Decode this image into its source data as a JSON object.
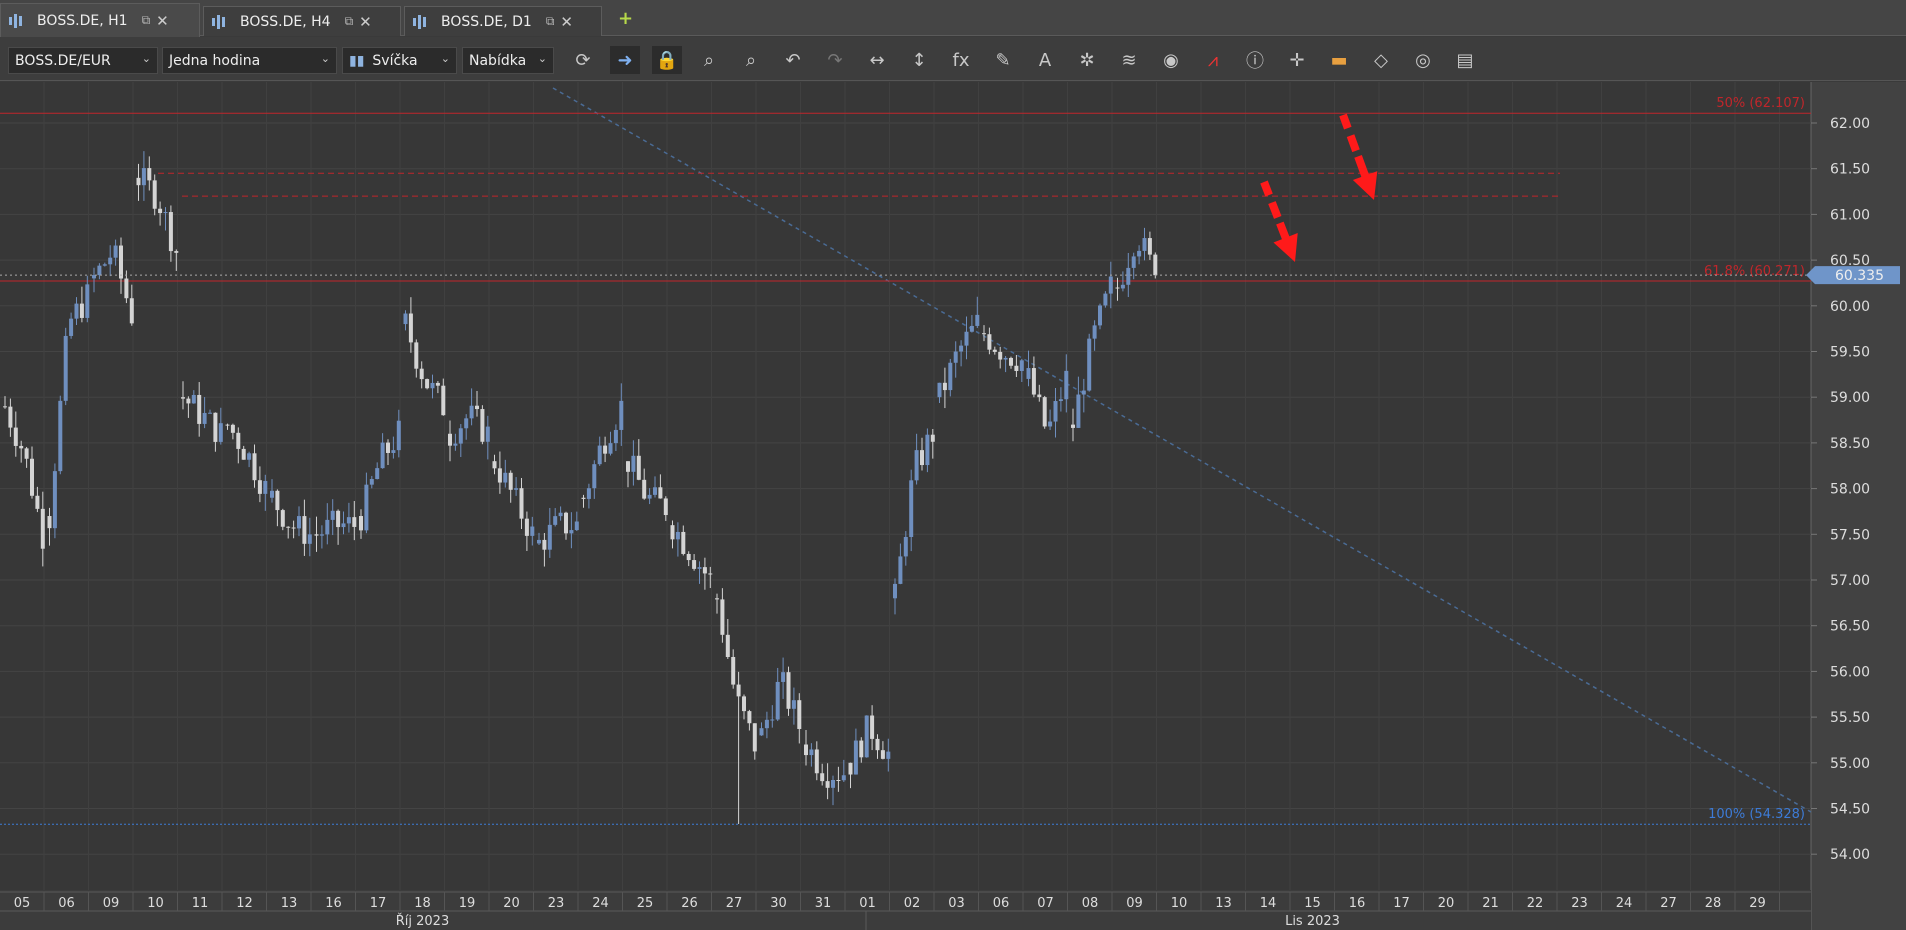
{
  "tabs": [
    {
      "label": "BOSS.DE, H1",
      "active": true
    },
    {
      "label": "BOSS.DE, H4",
      "active": false
    },
    {
      "label": "BOSS.DE, D1",
      "active": false
    }
  ],
  "toolbar": {
    "symbol": "BOSS.DE/EUR",
    "timeframe": "Jedna hodina",
    "chart_type": "Svíčka",
    "price_side": "Nabídka",
    "icons": [
      "refresh-icon",
      "autoscroll-icon",
      "lock-icon",
      "zoom-in-icon",
      "zoom-box-icon",
      "undo-icon",
      "redo-icon",
      "horizontal-scale-icon",
      "vertical-scale-icon",
      "fx-icon",
      "pencil-icon",
      "compass-icon",
      "objects-icon",
      "layers-icon",
      "eye-icon",
      "signal-icon",
      "info-icon",
      "crosshair-icon",
      "color-bar-icon",
      "paint-bucket-icon",
      "aperture-icon",
      "save-icon"
    ],
    "icon_glyphs": [
      "⟳",
      "➜",
      "🔒",
      "⌕",
      "⌕",
      "↶",
      "↷",
      "↔",
      "↕",
      "fx",
      "✎",
      "A",
      "✲",
      "≋",
      "◉",
      "⩘",
      "ⓘ",
      "✛",
      "▬",
      "◇",
      "◎",
      "▤"
    ]
  },
  "colors": {
    "bull": "#6f8fbf",
    "bear": "#d4d4d4",
    "fib_red": "#c0262b",
    "fib_blue": "#3d7bd6",
    "arrow": "#ff1a1a",
    "current": "#6f95c9"
  },
  "chart_data": {
    "type": "candlestick",
    "ylim": [
      53.6,
      62.5
    ],
    "y_ticks": [
      "54.00",
      "54.50",
      "55.00",
      "55.50",
      "56.00",
      "56.50",
      "57.00",
      "57.50",
      "58.00",
      "58.50",
      "59.00",
      "59.50",
      "60.00",
      "60.50",
      "61.00",
      "61.50",
      "62.00"
    ],
    "x_labels": [
      "05",
      "06",
      "09",
      "10",
      "11",
      "12",
      "13",
      "16",
      "17",
      "18",
      "19",
      "20",
      "23",
      "24",
      "25",
      "26",
      "27",
      "30",
      "31",
      "01",
      "02",
      "03",
      "06",
      "07",
      "08",
      "09",
      "10",
      "13",
      "14",
      "15",
      "16",
      "17",
      "20",
      "21",
      "22",
      "23",
      "24",
      "27",
      "28",
      "29"
    ],
    "month_labels": [
      {
        "label": "Říj 2023",
        "at_index": 9
      },
      {
        "label": "Lis 2023",
        "at_index": 29
      }
    ],
    "daily_path": [
      [
        58.9,
        58.4,
        57.5
      ],
      [
        57.7,
        59.8,
        60.1
      ],
      [
        60.3,
        60.6,
        59.9
      ],
      [
        61.4,
        61.2,
        60.6
      ],
      [
        59.0,
        58.8,
        58.6
      ],
      [
        58.7,
        58.4,
        58.0
      ],
      [
        57.9,
        57.6,
        57.5
      ],
      [
        57.5,
        57.6,
        57.6
      ],
      [
        57.7,
        58.3,
        58.6
      ],
      [
        59.8,
        59.2,
        58.9
      ],
      [
        58.6,
        58.8,
        58.6
      ],
      [
        58.3,
        57.9,
        57.5
      ],
      [
        57.4,
        57.6,
        57.6
      ],
      [
        57.9,
        58.5,
        58.9
      ],
      [
        58.3,
        57.9,
        57.8
      ],
      [
        57.6,
        57.3,
        57.0
      ],
      [
        56.8,
        55.7,
        55.2
      ],
      [
        55.3,
        55.9,
        55.4
      ],
      [
        55.2,
        54.9,
        54.9
      ],
      [
        55.0,
        55.4,
        55.1
      ],
      [
        56.8,
        58.2,
        58.6
      ],
      [
        59.0,
        59.5,
        59.8
      ],
      [
        59.7,
        59.5,
        59.4
      ],
      [
        59.2,
        58.6,
        59.2
      ],
      [
        58.7,
        59.6,
        60.2
      ],
      [
        60.2,
        60.8,
        60.335
      ]
    ],
    "fib_levels": [
      {
        "label": "50% (62.107)",
        "price": 62.107,
        "color": "red"
      },
      {
        "label": "61.8% (60.271)",
        "price": 60.271,
        "color": "red"
      },
      {
        "label": "100% (54.328)",
        "price": 54.328,
        "color": "blue"
      }
    ],
    "resistance_lines": [
      61.45,
      61.2
    ],
    "current_price": "60.335",
    "low_wick": 54.33
  }
}
